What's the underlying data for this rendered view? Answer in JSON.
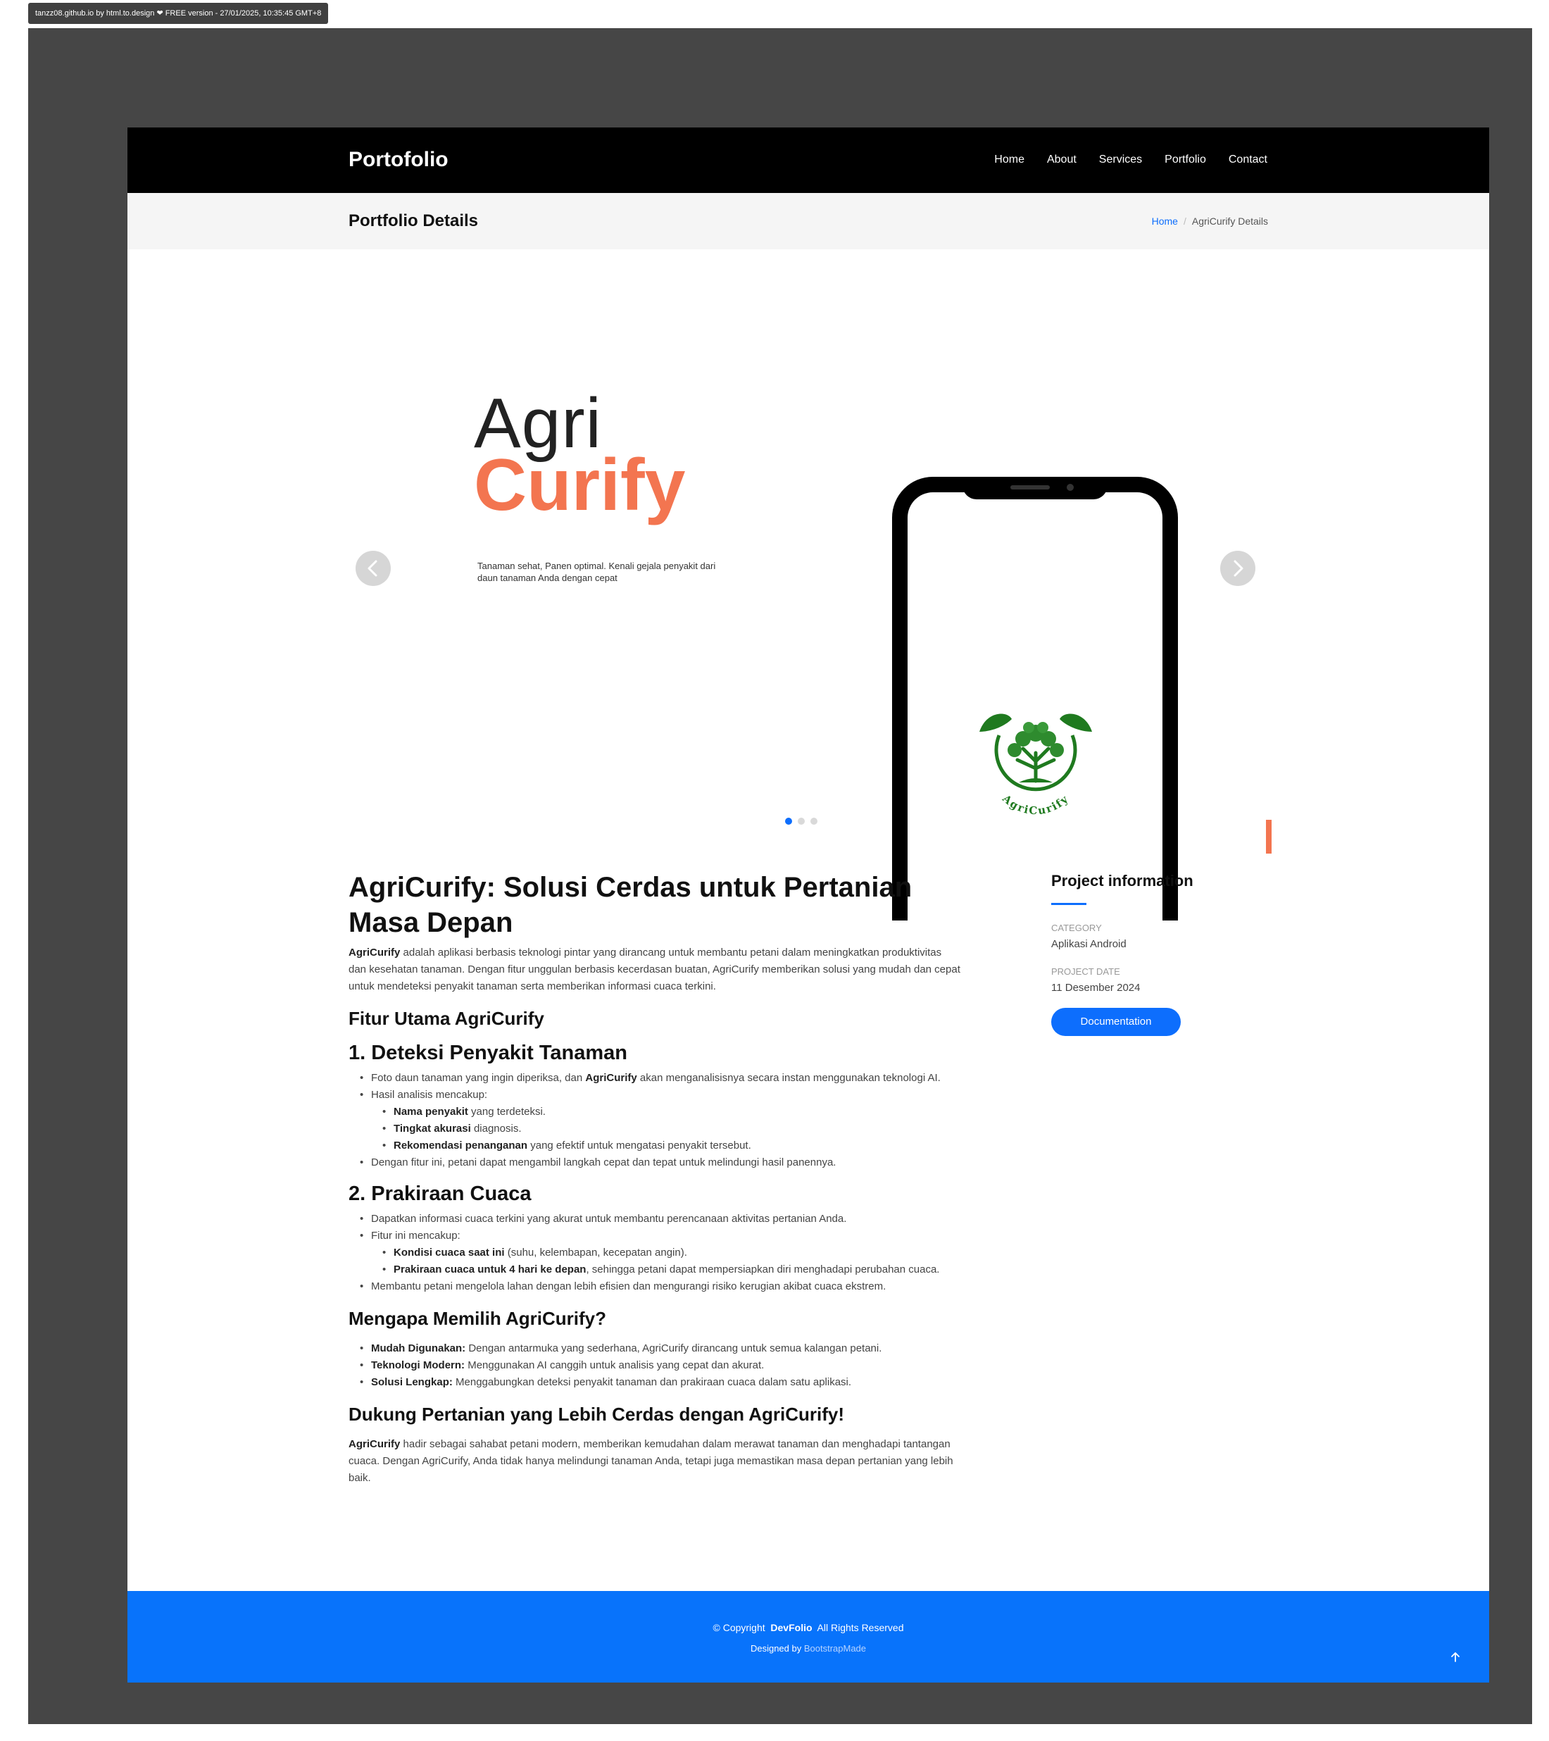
{
  "browser_badge": "tanzz08.github.io by html.to.design ❤ FREE version - 27/01/2025, 10:35:45 GMT+8",
  "header": {
    "brand": "Portofolio",
    "nav": [
      "Home",
      "About",
      "Services",
      "Portfolio",
      "Contact"
    ]
  },
  "breadcrumb": {
    "title": "Portfolio Details",
    "home": "Home",
    "separator": "/",
    "current": "AgriCurify Details"
  },
  "slider": {
    "logo_line1": "Agri",
    "logo_line2": "Curify",
    "tagline": "Tanaman sehat, Panen optimal. Kenali gejala penyakit dari daun tanaman Anda dengan cepat",
    "app_logo_text": "AgriCurify",
    "dots": 3,
    "active_dot": 1
  },
  "article": {
    "title": "AgriCurify: Solusi Cerdas untuk Pertanian Masa Depan",
    "intro_bold": "AgriCurify",
    "intro_rest": " adalah aplikasi berbasis teknologi pintar yang dirancang untuk membantu petani dalam meningkatkan produktivitas dan kesehatan tanaman. Dengan fitur unggulan berbasis kecerdasan buatan, AgriCurify memberikan solusi yang mudah dan cepat untuk mendeteksi penyakit tanaman serta memberikan informasi cuaca terkini.",
    "features_heading": "Fitur Utama AgriCurify",
    "f1_heading": "1. Deteksi Penyakit Tanaman",
    "f1_item1_a": "Foto daun tanaman yang ingin diperiksa, dan ",
    "f1_item1_b": "AgriCurify",
    "f1_item1_c": " akan menganalisisnya secara instan menggunakan teknologi AI.",
    "f1_item2": "Hasil analisis mencakup:",
    "f1_sub1_b": "Nama penyakit",
    "f1_sub1_r": " yang terdeteksi.",
    "f1_sub2_b": "Tingkat akurasi",
    "f1_sub2_r": " diagnosis.",
    "f1_sub3_b": "Rekomendasi penanganan",
    "f1_sub3_r": " yang efektif untuk mengatasi penyakit tersebut.",
    "f1_item3": "Dengan fitur ini, petani dapat mengambil langkah cepat dan tepat untuk melindungi hasil panennya.",
    "f2_heading": "2. Prakiraan Cuaca",
    "f2_item1": "Dapatkan informasi cuaca terkini yang akurat untuk membantu perencanaan aktivitas pertanian Anda.",
    "f2_item2": "Fitur ini mencakup:",
    "f2_sub1_b": "Kondisi cuaca saat ini",
    "f2_sub1_r": " (suhu, kelembapan, kecepatan angin).",
    "f2_sub2_b": "Prakiraan cuaca untuk 4 hari ke depan",
    "f2_sub2_r": ", sehingga petani dapat mempersiapkan diri menghadapi perubahan cuaca.",
    "f2_item3": "Membantu petani mengelola lahan dengan lebih efisien dan mengurangi risiko kerugian akibat cuaca ekstrem.",
    "why_heading": "Mengapa Memilih AgriCurify?",
    "why1_b": "Mudah Digunakan:",
    "why1_r": " Dengan antarmuka yang sederhana, AgriCurify dirancang untuk semua kalangan petani.",
    "why2_b": "Teknologi Modern:",
    "why2_r": " Menggunakan AI canggih untuk analisis yang cepat dan akurat.",
    "why3_b": "Solusi Lengkap:",
    "why3_r": " Menggabungkan deteksi penyakit tanaman dan prakiraan cuaca dalam satu aplikasi.",
    "closing_heading": "Dukung Pertanian yang Lebih Cerdas dengan AgriCurify!",
    "closing_bold": "AgriCurify",
    "closing_rest": " hadir sebagai sahabat petani modern, memberikan kemudahan dalam merawat tanaman dan menghadapi tantangan cuaca. Dengan AgriCurify, Anda tidak hanya melindungi tanaman Anda, tetapi juga memastikan masa depan pertanian yang lebih baik."
  },
  "project_info": {
    "title": "Project information",
    "category_label": "Category",
    "category_value": "Aplikasi Android",
    "date_label": "Project Date",
    "date_value": "11 Desember 2024",
    "button": "Documentation"
  },
  "footer": {
    "copyright_prefix": "© Copyright",
    "brand": "DevFolio",
    "rights": "All Rights Reserved",
    "designed_by": "Designed by",
    "designer": "BootstrapMade"
  },
  "colors": {
    "accent": "#0d6efd",
    "brand_orange": "#f37550",
    "leaf_green": "#1f7a1f",
    "footer_blue": "#0873fb",
    "frame_gray": "#464646"
  }
}
